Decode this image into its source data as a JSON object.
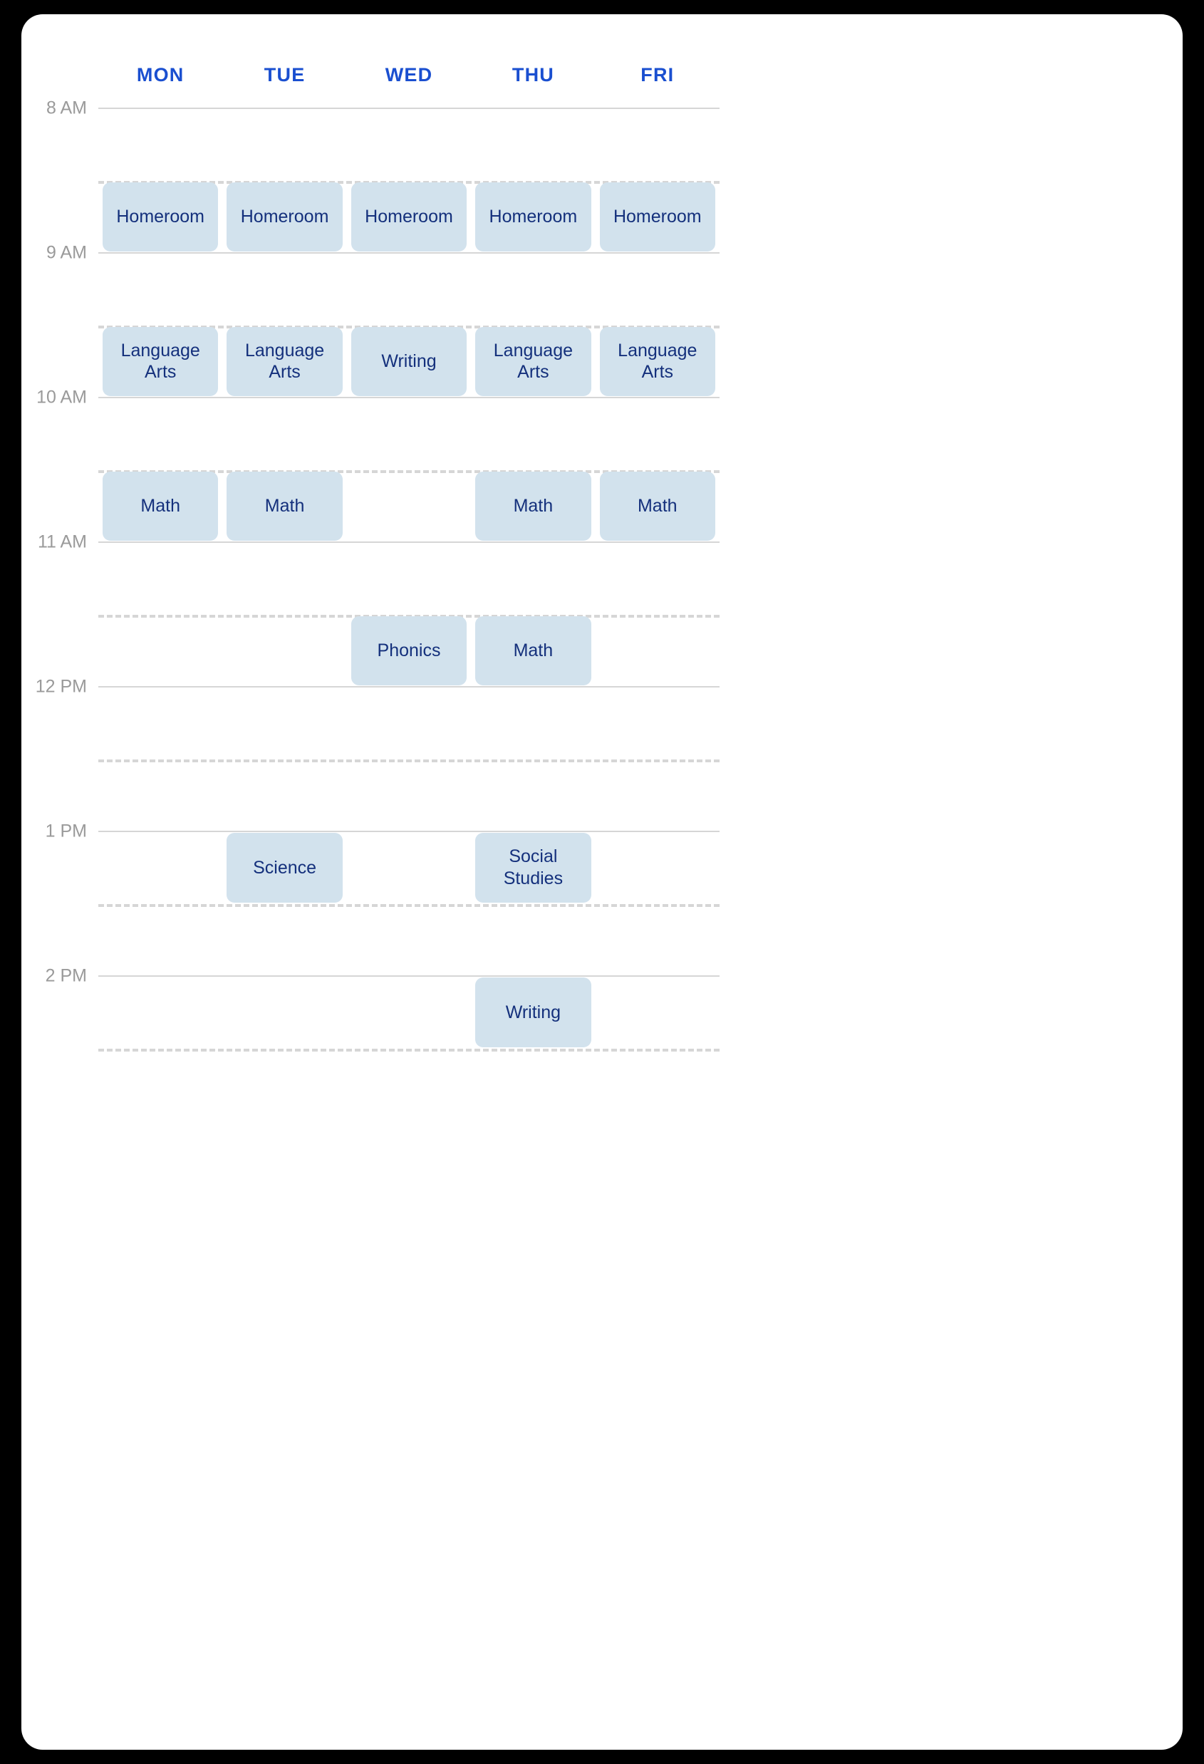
{
  "schedule": {
    "days": [
      {
        "key": "mon",
        "label": "MON"
      },
      {
        "key": "tue",
        "label": "TUE"
      },
      {
        "key": "wed",
        "label": "WED"
      },
      {
        "key": "thu",
        "label": "THU"
      },
      {
        "key": "fri",
        "label": "FRI"
      }
    ],
    "time_labels": [
      {
        "label": "8 AM",
        "hour": 8
      },
      {
        "label": "9 AM",
        "hour": 9
      },
      {
        "label": "10 AM",
        "hour": 10
      },
      {
        "label": "11 AM",
        "hour": 11
      },
      {
        "label": "12 PM",
        "hour": 12
      },
      {
        "label": "1 PM",
        "hour": 13
      },
      {
        "label": "2 PM",
        "hour": 14
      }
    ],
    "colors": {
      "day_header": "#1a4fd0",
      "time_label": "#9a9a9a",
      "hour_line": "#d6d6d6",
      "half_hour_line": "#d6d6d6",
      "event_background": "#d2e2ed",
      "event_text": "#14307c",
      "card_background": "#ffffff",
      "page_background": "#000000"
    },
    "events": [
      {
        "label": "Homeroom",
        "day": 0,
        "start": 8.5,
        "end": 9.0
      },
      {
        "label": "Homeroom",
        "day": 1,
        "start": 8.5,
        "end": 9.0
      },
      {
        "label": "Homeroom",
        "day": 2,
        "start": 8.5,
        "end": 9.0
      },
      {
        "label": "Homeroom",
        "day": 3,
        "start": 8.5,
        "end": 9.0
      },
      {
        "label": "Homeroom",
        "day": 4,
        "start": 8.5,
        "end": 9.0
      },
      {
        "label": "Language Arts",
        "day": 0,
        "start": 9.5,
        "end": 10.0
      },
      {
        "label": "Language Arts",
        "day": 1,
        "start": 9.5,
        "end": 10.0
      },
      {
        "label": "Writing",
        "day": 2,
        "start": 9.5,
        "end": 10.0
      },
      {
        "label": "Language Arts",
        "day": 3,
        "start": 9.5,
        "end": 10.0
      },
      {
        "label": "Language Arts",
        "day": 4,
        "start": 9.5,
        "end": 10.0
      },
      {
        "label": "Math",
        "day": 0,
        "start": 10.5,
        "end": 11.0
      },
      {
        "label": "Math",
        "day": 1,
        "start": 10.5,
        "end": 11.0
      },
      {
        "label": "Math",
        "day": 3,
        "start": 10.5,
        "end": 11.0
      },
      {
        "label": "Math",
        "day": 4,
        "start": 10.5,
        "end": 11.0
      },
      {
        "label": "Phonics",
        "day": 2,
        "start": 11.5,
        "end": 12.0
      },
      {
        "label": "Math",
        "day": 3,
        "start": 11.5,
        "end": 12.0
      },
      {
        "label": "Science",
        "day": 1,
        "start": 13.0,
        "end": 13.5
      },
      {
        "label": "Social Studies",
        "day": 3,
        "start": 13.0,
        "end": 13.5
      },
      {
        "label": "Writing",
        "day": 3,
        "start": 14.0,
        "end": 14.5
      }
    ]
  }
}
